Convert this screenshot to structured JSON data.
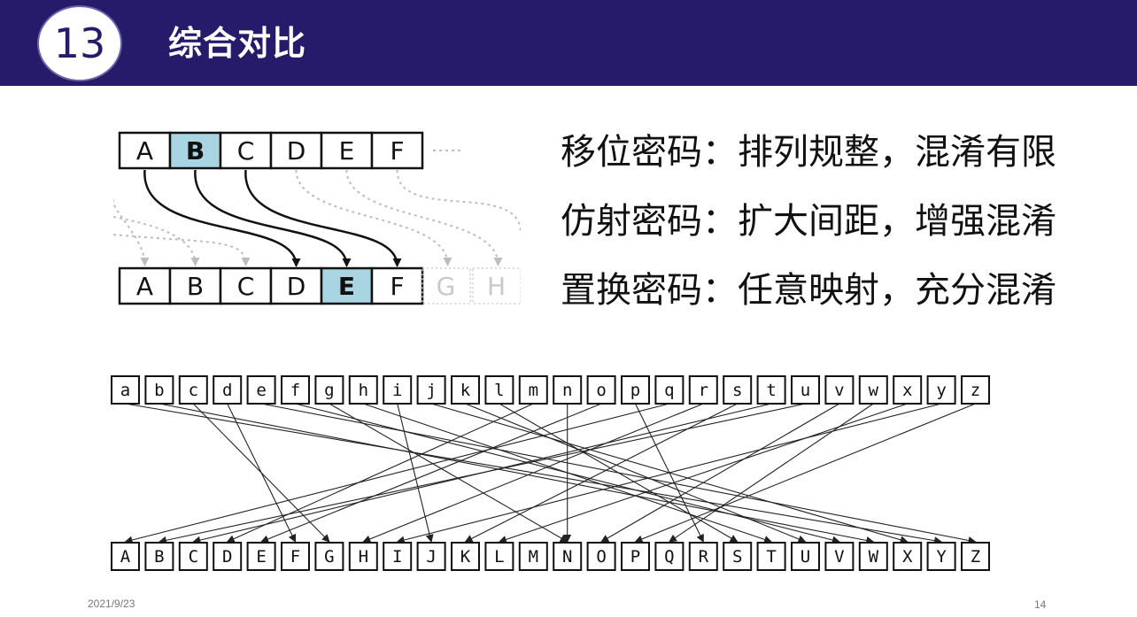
{
  "header": {
    "badge_number": "13",
    "title": "综合对比"
  },
  "summary": {
    "lines": [
      "移位密码：排列规整，混淆有限",
      "仿射密码：扩大间距，增强混淆",
      "置换密码：任意映射，充分混淆"
    ]
  },
  "shift_diagram": {
    "top_letters": [
      "A",
      "B",
      "C",
      "D",
      "E",
      "F"
    ],
    "bottom_letters": [
      "A",
      "B",
      "C",
      "D",
      "E",
      "F"
    ],
    "ghost_letters": [
      "G",
      "H"
    ],
    "top_highlight": "B",
    "bottom_highlight": "E",
    "highlight_color": "#a9d4e2",
    "arrows": [
      {
        "from": "A",
        "to": "D"
      },
      {
        "from": "B",
        "to": "E"
      },
      {
        "from": "C",
        "to": "F"
      }
    ]
  },
  "permutation_diagram": {
    "top_letters": [
      "a",
      "b",
      "c",
      "d",
      "e",
      "f",
      "g",
      "h",
      "i",
      "j",
      "k",
      "l",
      "m",
      "n",
      "o",
      "p",
      "q",
      "r",
      "s",
      "t",
      "u",
      "v",
      "w",
      "x",
      "y",
      "z"
    ],
    "bottom_letters": [
      "A",
      "B",
      "C",
      "D",
      "E",
      "F",
      "G",
      "H",
      "I",
      "J",
      "K",
      "L",
      "M",
      "N",
      "O",
      "P",
      "Q",
      "R",
      "S",
      "T",
      "U",
      "V",
      "W",
      "X",
      "Y",
      "Z"
    ],
    "mapping": [
      {
        "from": "a",
        "to": "Y"
      },
      {
        "from": "b",
        "to": "W"
      },
      {
        "from": "c",
        "to": "G"
      },
      {
        "from": "d",
        "to": "F"
      },
      {
        "from": "e",
        "to": "Z"
      },
      {
        "from": "f",
        "to": "V"
      },
      {
        "from": "g",
        "to": "N"
      },
      {
        "from": "h",
        "to": "T"
      },
      {
        "from": "i",
        "to": "J"
      },
      {
        "from": "j",
        "to": "X"
      },
      {
        "from": "k",
        "to": "U"
      },
      {
        "from": "l",
        "to": "S"
      },
      {
        "from": "m",
        "to": "D"
      },
      {
        "from": "n",
        "to": "N"
      },
      {
        "from": "o",
        "to": "E"
      },
      {
        "from": "p",
        "to": "R"
      },
      {
        "from": "q",
        "to": "A"
      },
      {
        "from": "r",
        "to": "H"
      },
      {
        "from": "s",
        "to": "K"
      },
      {
        "from": "t",
        "to": "C"
      },
      {
        "from": "u",
        "to": "B"
      },
      {
        "from": "v",
        "to": "O"
      },
      {
        "from": "w",
        "to": "Q"
      },
      {
        "from": "x",
        "to": "L"
      },
      {
        "from": "y",
        "to": "I"
      },
      {
        "from": "z",
        "to": "P"
      }
    ]
  },
  "footer": {
    "date": "2021/9/23",
    "page": "14"
  },
  "colors": {
    "header_bg": "#261a6b",
    "text": "#111111"
  }
}
